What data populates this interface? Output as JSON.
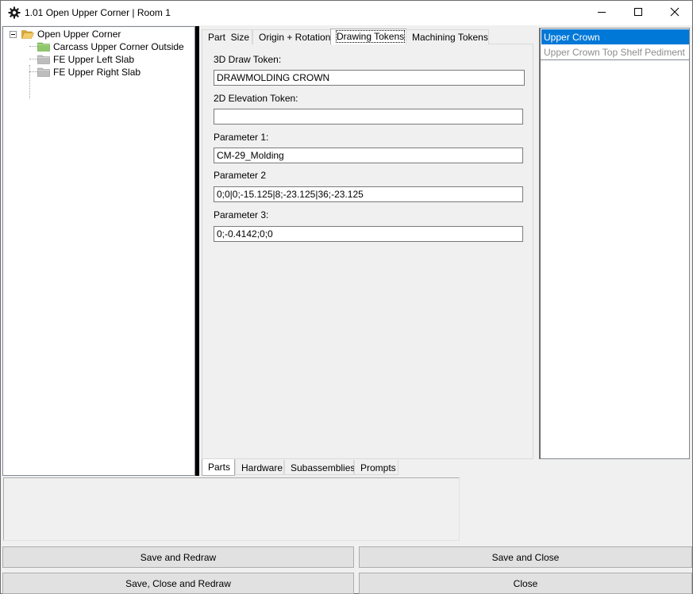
{
  "window": {
    "title": "1.01 Open Upper Corner | Room 1",
    "icon": "gear-icon",
    "controls": [
      "minimize-icon",
      "maximize-icon",
      "close-icon"
    ]
  },
  "tree": {
    "root": {
      "label": "Open Upper Corner",
      "icon": "folder-open-icon",
      "expanded": true
    },
    "children": [
      {
        "label": "Carcass Upper Corner Outside",
        "icon": "folder-green-icon"
      },
      {
        "label": "FE Upper Left Slab",
        "icon": "folder-gray-icon"
      },
      {
        "label": "FE Upper Right Slab",
        "icon": "folder-gray-icon"
      }
    ]
  },
  "top_tabs": [
    {
      "label": "Part  Size",
      "active": false
    },
    {
      "label": "Origin + Rotation",
      "active": false
    },
    {
      "label": "Drawing Tokens",
      "active": true
    },
    {
      "label": "Machining Tokens",
      "active": false
    }
  ],
  "form": {
    "draw3d_label": "3D Draw Token:",
    "draw3d_value": "DRAWMOLDING CROWN",
    "elev2d_label": "2D Elevation Token:",
    "elev2d_value": "",
    "param1_label": "Parameter 1:",
    "param1_value": "CM-29_Molding",
    "param2_label": "Parameter 2",
    "param2_value": "0;0|0;-15.125|8;-23.125|36;-23.125",
    "param3_label": "Parameter 3:",
    "param3_value": "0;-0.4142;0;0"
  },
  "parts_list": [
    {
      "label": "Upper Crown",
      "selected": true,
      "enabled": true
    },
    {
      "label": "Upper Crown Top Shelf Pediment",
      "selected": false,
      "enabled": false
    }
  ],
  "bottom_tabs": [
    {
      "label": "Parts",
      "active": true
    },
    {
      "label": "Hardware",
      "active": false
    },
    {
      "label": "Subassemblies",
      "active": false
    },
    {
      "label": "Prompts",
      "active": false
    }
  ],
  "buttons": {
    "save_redraw": "Save and Redraw",
    "save_close": "Save and Close",
    "save_close_redraw": "Save, Close and Redraw",
    "close": "Close"
  },
  "colors": {
    "selection": "#0078d7",
    "folder_open": "#e8c15c",
    "folder_green": "#8fc86a",
    "folder_gray": "#b4b4b4"
  }
}
